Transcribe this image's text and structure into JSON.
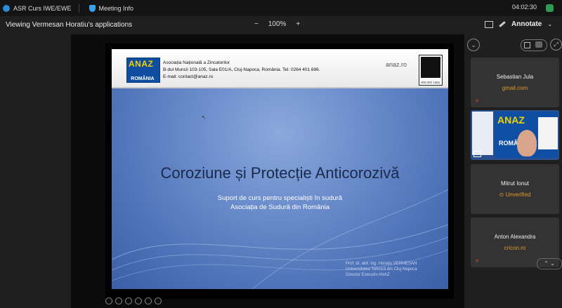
{
  "titlebar": {
    "app_name": "ASR Curs IWE/EWE",
    "meeting_info": "Meeting Info",
    "clock": "04:02:30"
  },
  "view": {
    "title": "Viewing Vermesan Horatiu's applications",
    "zoom_minus": "−",
    "zoom_level": "100%",
    "zoom_plus": "+",
    "annotate_label": "Annotate"
  },
  "slide": {
    "logo_word": "ANAZ",
    "logo_country": "ROMÂNIA",
    "org_line1": "Asociația Națională a Zincatorilor",
    "org_line2": "B-dul Muncii 103-105, Sala E01/A, Cluj-Napoca, România. Tel: 0264 401 696.",
    "org_line3": "E-mail: contact@anaz.ro",
    "site": "anaz.ro",
    "iso_text": "EN ISO 1461",
    "title": "Coroziune și Protecție Anticorozivă",
    "subtitle_line1": "Suport de curs pentru specialiști în sudură",
    "subtitle_line2": "Asociația de Sudură din România",
    "author_line1": "Prof. dr. abil. ing. Horațiu VERMEȘAN",
    "author_line2": "Universitatea Tehnică din Cluj-Napoca",
    "author_line3": "Director Executiv ANAZ"
  },
  "participants": [
    {
      "name": "Sebastian Jula",
      "sub": "gmail.com"
    },
    {
      "name": "Mitrut Ionut",
      "sub": "Unverified"
    },
    {
      "name": "Anton Alexandra",
      "sub": "cricon.ro"
    }
  ],
  "video_tile": {
    "bg_word": "ANAZ",
    "bg_word2": "ROMÂNIA"
  }
}
